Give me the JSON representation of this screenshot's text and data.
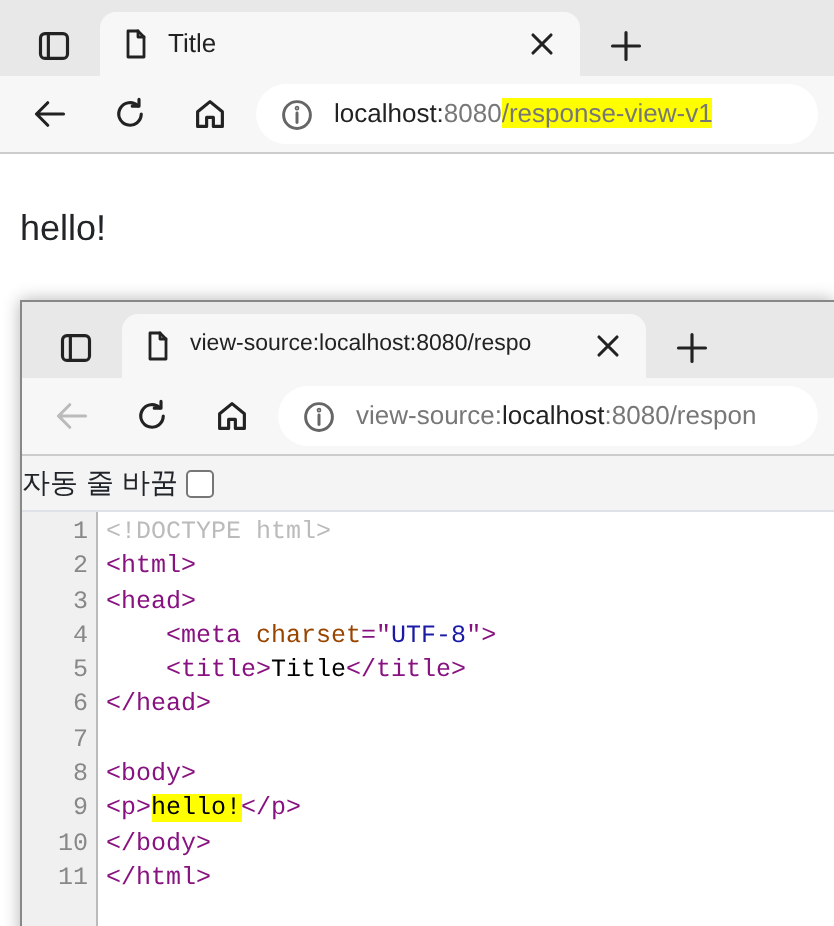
{
  "browser": {
    "tab": {
      "title": "Title"
    },
    "back_disabled": false,
    "address": [
      {
        "kind": "host",
        "text": "localhost:"
      },
      {
        "kind": "port",
        "text": "8080"
      },
      {
        "kind": "path",
        "text": "/response-view-v1",
        "highlight": true
      }
    ],
    "page_text": "hello!"
  },
  "source_window": {
    "tab": {
      "title": "view-source:localhost:8080/respo"
    },
    "back_disabled": true,
    "address": [
      {
        "kind": "scheme",
        "text": "view-source:"
      },
      {
        "kind": "host",
        "text": "localhost"
      },
      {
        "kind": "port",
        "text": ":8080/respon"
      }
    ],
    "wrap_toggle": {
      "label": "자동 줄 바꿈",
      "checked": false
    },
    "lines": [
      {
        "number": "1",
        "tokens": [
          {
            "kind": "doctype",
            "text": "<!DOCTYPE html>"
          }
        ]
      },
      {
        "number": "2",
        "tokens": [
          {
            "kind": "tag",
            "text": "<html>"
          }
        ]
      },
      {
        "number": "3",
        "tokens": [
          {
            "kind": "tag",
            "text": "<head>"
          }
        ]
      },
      {
        "number": "4",
        "tokens": [
          {
            "kind": "tag",
            "text": "    <meta "
          },
          {
            "kind": "attr",
            "text": "charset"
          },
          {
            "kind": "tag",
            "text": "=\""
          },
          {
            "kind": "value",
            "text": "UTF-8"
          },
          {
            "kind": "tag",
            "text": "\">"
          }
        ]
      },
      {
        "number": "5",
        "tokens": [
          {
            "kind": "tag",
            "text": "    <title>"
          },
          {
            "kind": "text",
            "text": "Title"
          },
          {
            "kind": "tag",
            "text": "</title>"
          }
        ]
      },
      {
        "number": "6",
        "tokens": [
          {
            "kind": "tag",
            "text": "</head>"
          }
        ]
      },
      {
        "number": "7"
      },
      {
        "number": "8",
        "tokens": [
          {
            "kind": "tag",
            "text": "<body>"
          }
        ]
      },
      {
        "number": "9",
        "tokens": [
          {
            "kind": "tag",
            "text": "<p>"
          },
          {
            "kind": "text",
            "text": "hello!",
            "highlight": true
          },
          {
            "kind": "tag",
            "text": "</p>"
          }
        ]
      },
      {
        "number": "10",
        "tokens": [
          {
            "kind": "tag",
            "text": "</body>"
          }
        ]
      },
      {
        "number": "11",
        "tokens": [
          {
            "kind": "tag",
            "text": "</html>"
          }
        ]
      }
    ]
  }
}
